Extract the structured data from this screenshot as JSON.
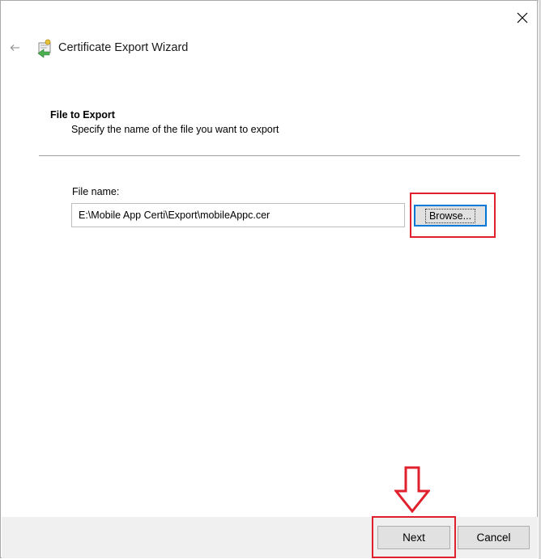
{
  "window": {
    "title": "Certificate Export Wizard",
    "back_icon": "back-arrow-icon",
    "close_icon": "close-icon",
    "app_icon": "certificate-wizard-icon"
  },
  "section": {
    "title": "File to Export",
    "description": "Specify the name of the file you want to export"
  },
  "file_field": {
    "label": "File name:",
    "value": "E:\\Mobile App Certi\\Export\\mobileAppc.cer"
  },
  "buttons": {
    "browse": "Browse...",
    "next": "Next",
    "cancel": "Cancel"
  },
  "annotations": {
    "highlight_color": "#e0202c",
    "arrow_icon": "down-arrow-icon"
  }
}
